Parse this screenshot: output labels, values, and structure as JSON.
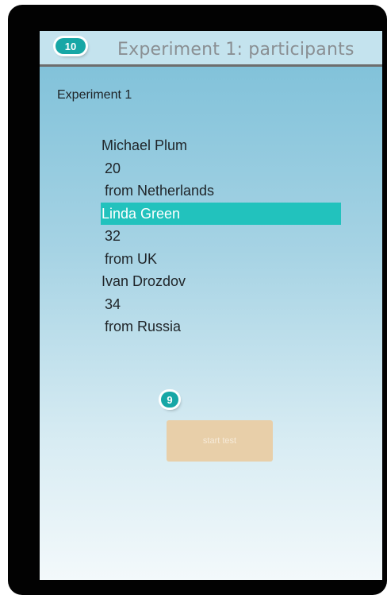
{
  "header": {
    "badge": "10",
    "title": "Experiment 1: participants"
  },
  "experiment_label": "Experiment 1",
  "participants": [
    {
      "name": "Michael Plum",
      "age": "20",
      "origin": "from Netherlands",
      "selected": false
    },
    {
      "name": "Linda Green",
      "age": "32",
      "origin": "from UK",
      "selected": true
    },
    {
      "name": "Ivan Drozdov",
      "age": "34",
      "origin": "from Russia",
      "selected": false
    }
  ],
  "step_badge": "9",
  "start_button": {
    "label": "start test"
  },
  "colors": {
    "accent": "#22c2bd",
    "badge": "#17a7a6",
    "button": "#e8cfa9",
    "titlebar": "#c4e3ee"
  }
}
